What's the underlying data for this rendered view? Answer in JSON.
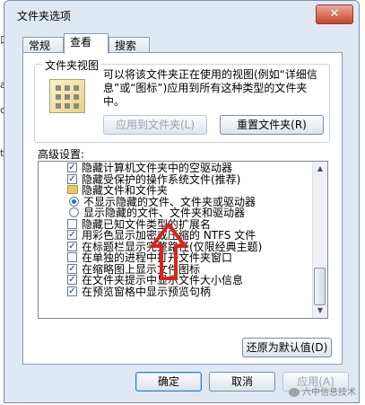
{
  "window": {
    "title": "文件夹选项",
    "close_label": "✕"
  },
  "edge_glyphs": [
    "口",
    "a",
    "c)",
    "t"
  ],
  "tabs": [
    {
      "label": "常规"
    },
    {
      "label": "查看"
    },
    {
      "label": "搜索"
    }
  ],
  "folder_view": {
    "legend": "文件夹视图",
    "description": "可以将该文件夹正在使用的视图(例如“详细信息”或“图标”)应用到所有这种类型的文件夹中。",
    "apply_button": "应用到文件夹(L)",
    "reset_button": "重置文件夹(R)"
  },
  "advanced": {
    "label": "高级设置:",
    "items": [
      {
        "type": "checkbox",
        "checked": true,
        "indent": 1,
        "label": "隐藏计算机文件夹中的空驱动器"
      },
      {
        "type": "checkbox",
        "checked": true,
        "indent": 1,
        "label": "隐藏受保护的操作系统文件(推荐)"
      },
      {
        "type": "folder",
        "indent": 0,
        "label": "隐藏文件和文件夹"
      },
      {
        "type": "radio",
        "checked": true,
        "indent": 2,
        "label": "不显示隐藏的文件、文件夹或驱动器"
      },
      {
        "type": "radio",
        "checked": false,
        "indent": 2,
        "label": "显示隐藏的文件、文件夹和驱动器"
      },
      {
        "type": "checkbox",
        "checked": false,
        "indent": 1,
        "label": "隐藏已知文件类型的扩展名"
      },
      {
        "type": "checkbox",
        "checked": true,
        "indent": 1,
        "label": "用彩色显示加密或压缩的 NTFS 文件"
      },
      {
        "type": "checkbox",
        "checked": true,
        "indent": 1,
        "label": "在标题栏显示完整路径(仅限经典主题)"
      },
      {
        "type": "checkbox",
        "checked": false,
        "indent": 1,
        "label": "在单独的进程中打开文件夹窗口"
      },
      {
        "type": "checkbox",
        "checked": true,
        "indent": 1,
        "label": "在缩略图上显示文件图标"
      },
      {
        "type": "checkbox",
        "checked": true,
        "indent": 1,
        "label": "在文件夹提示中显示文件大小信息"
      },
      {
        "type": "checkbox",
        "checked": true,
        "indent": 1,
        "label": "在预览窗格中显示预览句柄"
      }
    ]
  },
  "restore_button": "还原为默认值(D)",
  "footer": {
    "ok": "确定",
    "cancel": "取消",
    "apply": "应用(A)"
  },
  "watermark": "六中信息技术",
  "annotation_color": "#d9231c"
}
